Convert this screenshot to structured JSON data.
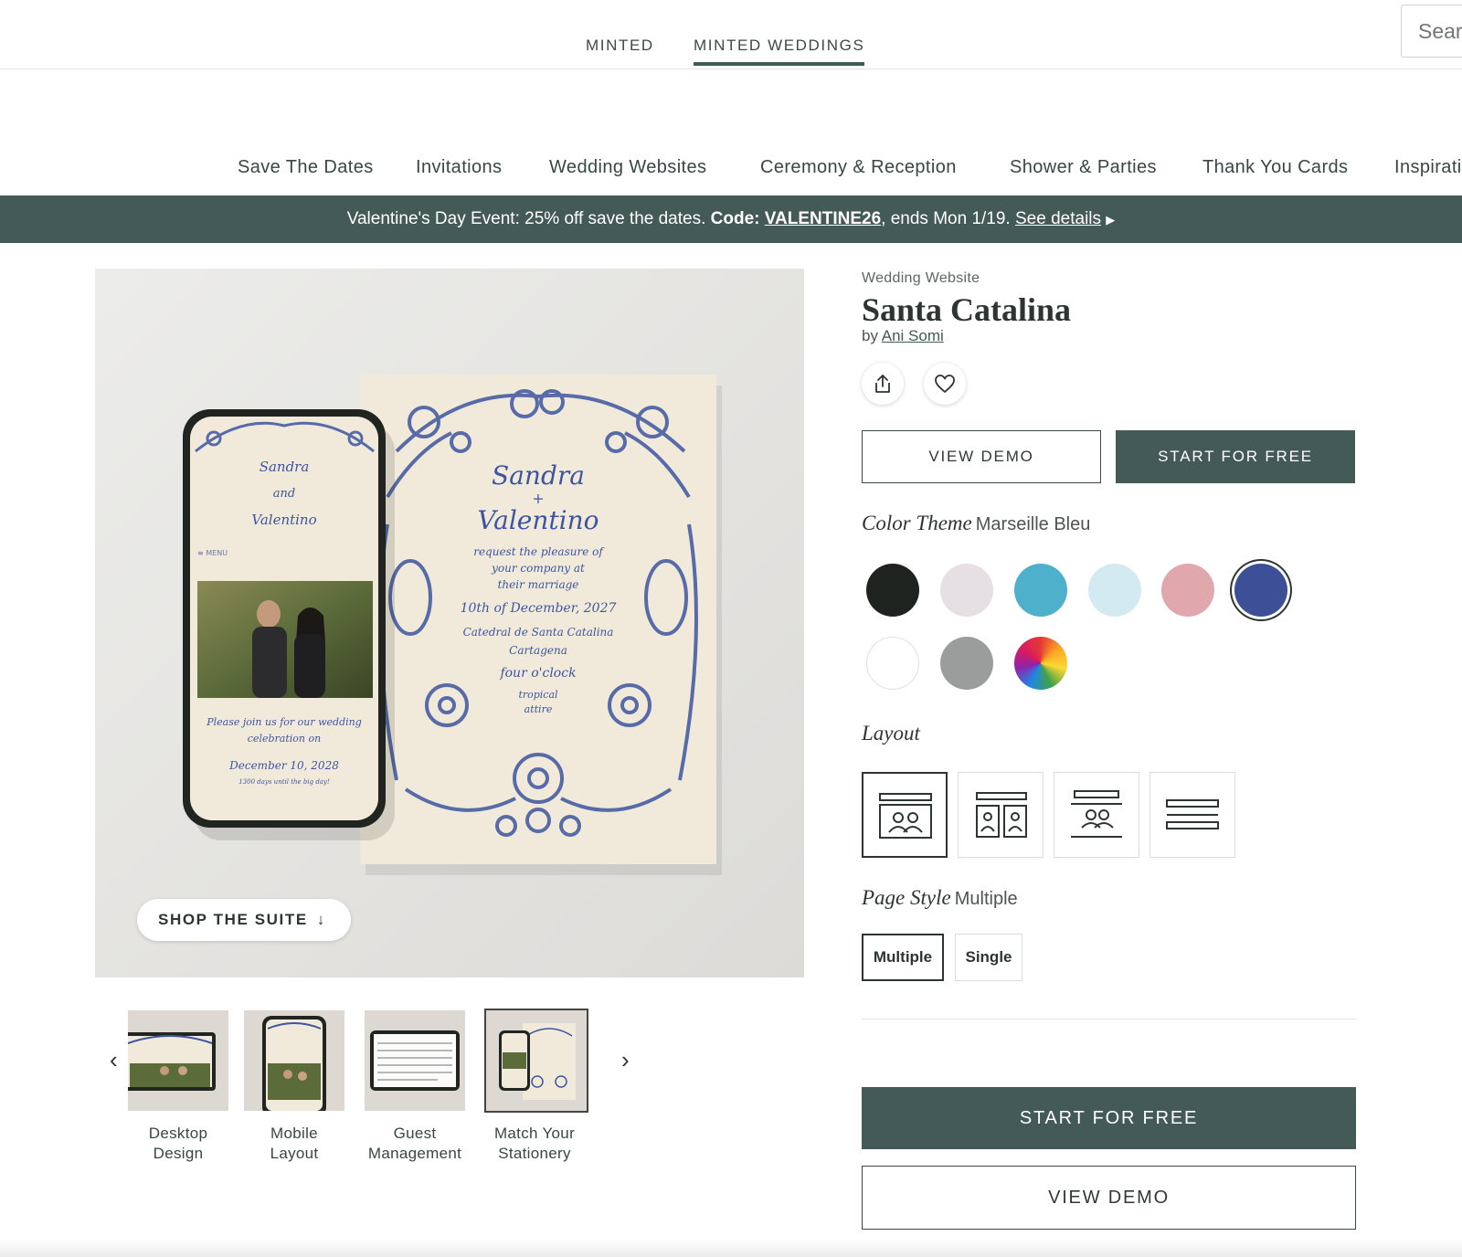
{
  "brand_tabs": {
    "minted": "MINTED",
    "weddings": "MINTED WEDDINGS"
  },
  "search": {
    "placeholder": "Search"
  },
  "nav": {
    "items": [
      "Save The Dates",
      "Invitations",
      "Wedding Websites",
      "Ceremony & Reception",
      "Shower & Parties",
      "Thank You Cards",
      "Inspiration"
    ]
  },
  "promo": {
    "text": "Valentine's Day Event: 25% off save the dates.",
    "code_label": "Code:",
    "code": "VALENTINE26",
    "ends": ", ends Mon 1/19.",
    "details": "See details",
    "arrow_icon": "play-triangle"
  },
  "hero": {
    "shop_suite_label": "SHOP THE SUITE",
    "shop_suite_arrow": "↓",
    "phone_text": {
      "name1": "Sandra",
      "and": "and",
      "name2": "Valentino",
      "menu": "≡ MENU",
      "invite": "Please join us for our wedding",
      "celebration": "celebration on",
      "date": "December 10, 2028",
      "countdown": "1300 days until the big day!"
    },
    "card_text": {
      "name1": "Sandra",
      "plus": "+",
      "name2": "Valentino",
      "line1": "request the pleasure of",
      "line2": "your company at",
      "line3": "their marriage",
      "date": "10th of December, 2027",
      "venue": "Catedral de Santa Catalina",
      "city": "Cartagena",
      "time": "four o'clock",
      "attire1": "tropical",
      "attire2": "attire"
    }
  },
  "thumbnails": {
    "prev_icon": "‹",
    "next_icon": "›",
    "items": [
      {
        "line1": "Desktop",
        "line2": "Design"
      },
      {
        "line1": "Mobile",
        "line2": "Layout"
      },
      {
        "line1": "Guest",
        "line2": "Management"
      },
      {
        "line1": "Match Your",
        "line2": "Stationery"
      }
    ],
    "active_index": 3
  },
  "product": {
    "kind": "Wedding Website",
    "title": "Santa Catalina",
    "by": "by",
    "designer": "Ani Somi",
    "share_icon": "share-icon",
    "favorite_icon": "heart-icon"
  },
  "buttons": {
    "view_demo": "VIEW DEMO",
    "start_free": "START FOR FREE"
  },
  "color_theme": {
    "label": "Color Theme",
    "selected": "Marseille Bleu",
    "swatches": [
      "#1f2320",
      "#e6dfe3",
      "#4fb0cc",
      "#d3eaf0",
      "#e0a7ad",
      "#3d4f97",
      "#ffffff",
      "#9a9d9c",
      "multicolor"
    ],
    "selected_index": 5
  },
  "layout": {
    "label": "Layout",
    "selected_index": 0
  },
  "page_style": {
    "label": "Page Style",
    "selected": "Multiple",
    "options": [
      "Multiple",
      "Single"
    ]
  }
}
